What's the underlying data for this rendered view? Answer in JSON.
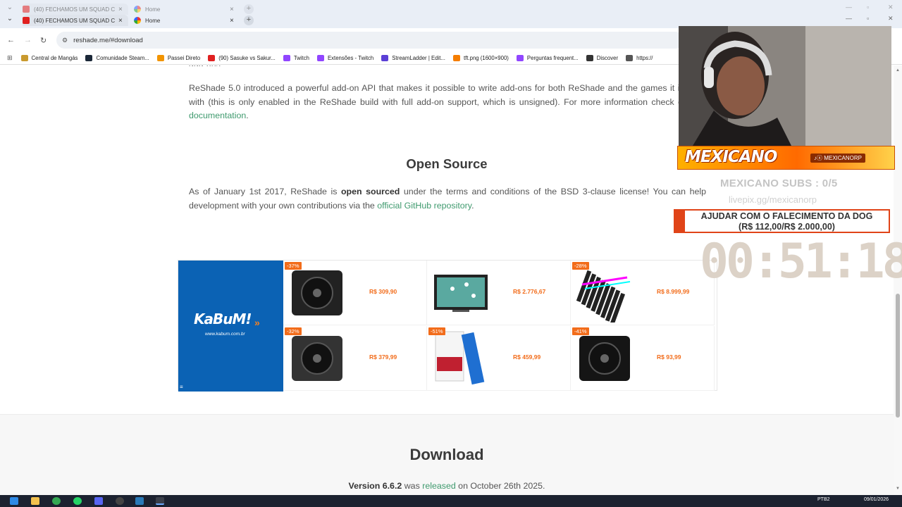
{
  "browser": {
    "tabs_behind": [
      {
        "title": "(40) FECHAMOS UM SQUAD C",
        "favicon": "youtube-icon"
      },
      {
        "title": "Home",
        "favicon": "home-icon"
      }
    ],
    "tabs": [
      {
        "title": "(40) FECHAMOS UM SQUAD C",
        "favicon": "youtube-icon"
      },
      {
        "title": "Home",
        "favicon": "home-icon"
      }
    ],
    "url": "reshade.me/#download",
    "bookmarks": [
      {
        "label": "Central de Mangás",
        "icon": "crown-icon",
        "color": "#c99a2e"
      },
      {
        "label": "Comunidade Steam...",
        "icon": "steam-icon",
        "color": "#1b2838"
      },
      {
        "label": "Passei Direto",
        "icon": "passei-direto-icon",
        "color": "#f29400"
      },
      {
        "label": "(90) Sasuke vs Sakur...",
        "icon": "youtube-icon",
        "color": "#e02020"
      },
      {
        "label": "Twitch",
        "icon": "twitch-icon",
        "color": "#9146ff"
      },
      {
        "label": "Extensões - Twitch",
        "icon": "twitch-icon",
        "color": "#9146ff"
      },
      {
        "label": "StreamLadder | Edit...",
        "icon": "streamladder-icon",
        "color": "#5b3fd6"
      },
      {
        "label": "tft.png (1600×900)",
        "icon": "blogger-icon",
        "color": "#f57d00"
      },
      {
        "label": "Perguntas frequent...",
        "icon": "twitch-icon",
        "color": "#9146ff"
      },
      {
        "label": "Discover",
        "icon": "discover-icon",
        "color": "#333333"
      },
      {
        "label": "https://",
        "icon": "globe-icon",
        "color": "#555555"
      }
    ]
  },
  "page": {
    "cut_line": "add-ons",
    "addon_para_1": "ReShade 5.0 introduced a powerful add-on API that makes it possible to write add-ons for both ReShade and the games it is used with (this is only enabled in the ReShade build with full add-on support, which is unsigned). For more information check out the ",
    "addon_link": "documentation",
    "addon_tail": ".",
    "open_source_heading": "Open Source",
    "os_para_1": "As of January 1st 2017, ReShade is ",
    "os_bold": "open sourced",
    "os_para_2": " under the terms and conditions of the BSD 3-clause license! You can help development with your own contributions via the ",
    "os_link": "official GitHub repository",
    "os_tail": ".",
    "download_heading": "Download",
    "version_label": "Version 6.6.2",
    "version_mid": " was ",
    "version_link": "released",
    "version_tail": " on October 26th 2025."
  },
  "ad": {
    "brand": "KaBuM!",
    "brand_sub": "www.kabum.com.br",
    "products": [
      {
        "badge": "-37%",
        "price": "R$ 309,90",
        "icon": "fan-pack-icon"
      },
      {
        "badge": "",
        "price": "R$ 2.776,67",
        "icon": "tv-frame-icon"
      },
      {
        "badge": "-28%",
        "price": "R$ 8.999,99",
        "icon": "ram-kit-icon"
      },
      {
        "badge": "-32%",
        "price": "R$ 379,99",
        "icon": "ryzen-box-icon"
      },
      {
        "badge": "-51%",
        "price": "R$ 459,99",
        "icon": "ssd-nv3-icon"
      },
      {
        "badge": "-41%",
        "price": "R$ 93,99",
        "icon": "case-fan-icon"
      }
    ]
  },
  "overlay": {
    "streamer": "MEXICANO",
    "handle": "♪ⓧ MEXICANORP",
    "subs": "MEXICANO SUBS : 0/5",
    "livepix": "livepix.gg/mexicanorp",
    "goal_line1": "AJUDAR COM O FALECIMENTO DA DOG",
    "goal_line2": "(R$ 112,00/R$ 2.000,00)",
    "timer": "00:51:18"
  },
  "taskbar": {
    "lang": "PTB2",
    "date": "09/01/2026"
  }
}
